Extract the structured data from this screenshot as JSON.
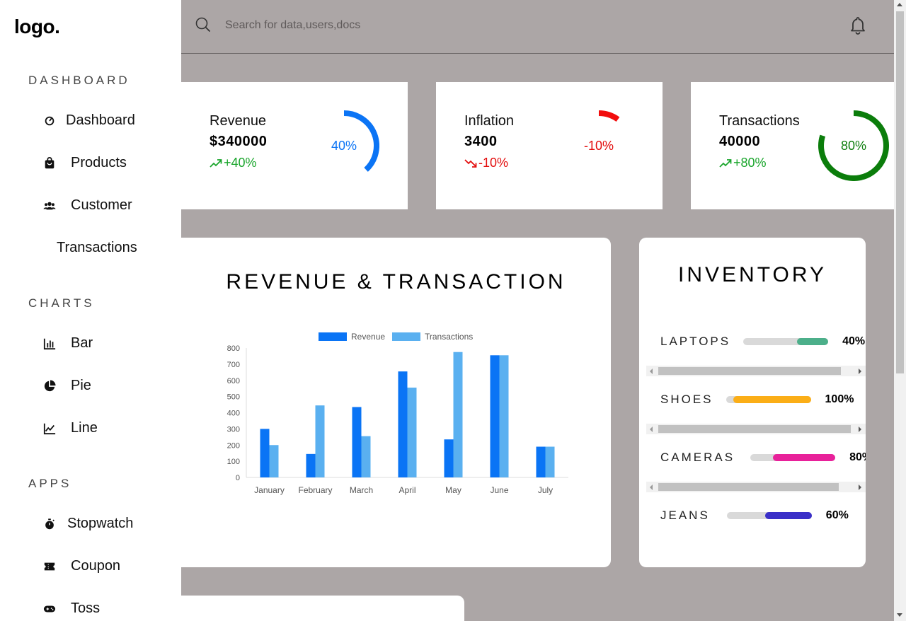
{
  "logo": "logo.",
  "search": {
    "placeholder": "Search for data,users,docs"
  },
  "sidebar": {
    "sections": [
      {
        "title": "DASHBOARD",
        "items": [
          {
            "label": "Dashboard",
            "icon": "dashboard-icon"
          },
          {
            "label": "Products",
            "icon": "shopping-bag-icon"
          },
          {
            "label": "Customer",
            "icon": "people-icon"
          },
          {
            "label": "Transactions",
            "icon": ""
          }
        ]
      },
      {
        "title": "CHARTS",
        "items": [
          {
            "label": "Bar",
            "icon": "bar-chart-icon"
          },
          {
            "label": "Pie",
            "icon": "pie-chart-icon"
          },
          {
            "label": "Line",
            "icon": "line-chart-icon"
          }
        ]
      },
      {
        "title": "APPS",
        "items": [
          {
            "label": "Stopwatch",
            "icon": "stopwatch-icon"
          },
          {
            "label": "Coupon",
            "icon": "coupon-icon"
          },
          {
            "label": "Toss",
            "icon": "gamepad-icon"
          }
        ]
      }
    ]
  },
  "cards": [
    {
      "label": "Revenue",
      "value": "$340000",
      "change": "+40%",
      "trend": "up",
      "ring_text": "40%",
      "percent": 40,
      "color": "#0b74f5",
      "change_color": "#19a52b"
    },
    {
      "label": "Inflation",
      "value": "3400",
      "change": "-10%",
      "trend": "down",
      "ring_text": "-10%",
      "percent": -10,
      "color": "#f20d0d",
      "change_color": "#e30d0d"
    },
    {
      "label": "Transactions",
      "value": "40000",
      "change": "+80%",
      "trend": "up",
      "ring_text": "80%",
      "percent": 80,
      "color": "#0b7d0b",
      "change_color": "#19a52b"
    }
  ],
  "revenue_chart": {
    "title": "REVENUE & TRANSACTION"
  },
  "chart_data": {
    "type": "bar",
    "categories": [
      "January",
      "February",
      "March",
      "April",
      "May",
      "June",
      "July"
    ],
    "series": [
      {
        "name": "Revenue",
        "values": [
          300,
          145,
          435,
          655,
          235,
          755,
          190
        ],
        "color": "#0a74f5"
      },
      {
        "name": "Transactions",
        "values": [
          200,
          445,
          255,
          555,
          775,
          755,
          190
        ],
        "color": "#5ab0f0"
      }
    ],
    "yticks": [
      "0",
      "100",
      "200",
      "300",
      "400",
      "500",
      "600",
      "700",
      "800"
    ],
    "ylim": [
      0,
      800
    ],
    "legend_position": "top"
  },
  "inventory": {
    "title": "INVENTORY",
    "items": [
      {
        "name": "LAPTOPS",
        "value": "40%",
        "fraction": 0.4,
        "color": "#4caf8a"
      },
      {
        "name": "SHOES",
        "value": "100%",
        "fraction": 1.0,
        "color": "#fbae17"
      },
      {
        "name": "CAMERAS",
        "value": "80%",
        "fraction": 0.8,
        "color": "#e8219a"
      },
      {
        "name": "JEANS",
        "value": "60%",
        "fraction": 0.6,
        "color": "#3a2fc8"
      }
    ]
  }
}
